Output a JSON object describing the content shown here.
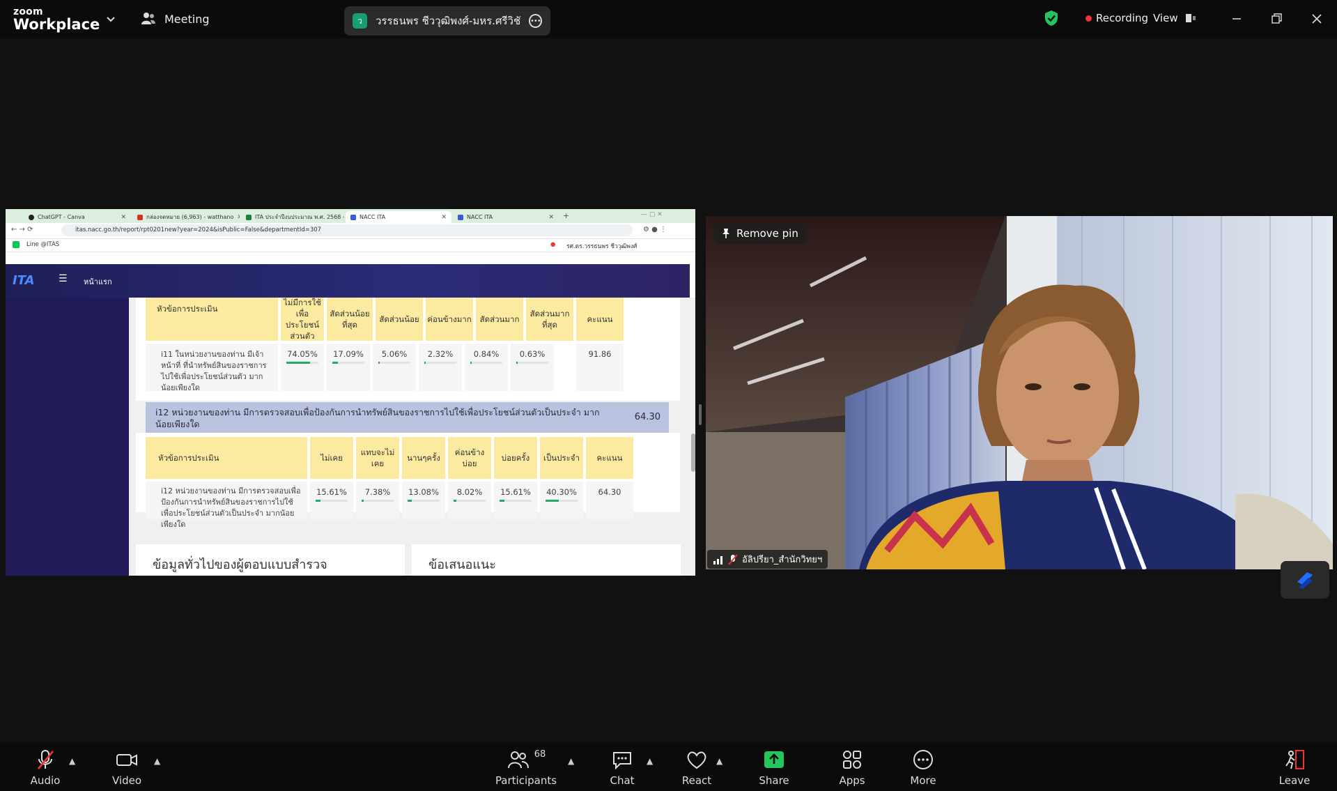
{
  "app": {
    "logo_line1": "zoom",
    "logo_line2": "Workplace",
    "meeting_label": "Meeting",
    "speaker_initial": "ว",
    "speaker_name": "วรรธนพร  ชีววุฒิพงศ์-มหร.ศรีวิชัย's sc",
    "recording_label": "Recording",
    "view_label": "View",
    "security_color": "#22c55e",
    "recording_color": "#f0323c"
  },
  "browser": {
    "tabs": [
      "ChatGPT - Canva",
      "กล่องจดหมาย (6,963) - watthano",
      "ITA ประจำปีงบประมาณ พ.ศ. 2568 -",
      "NACC ITA",
      "NACC ITA"
    ],
    "url": "itas.nacc.go.th/report/rpt0201new?year=2024&isPublic=False&departmentId=307",
    "bookmark": "Line @ITAS",
    "user": "รศ.ดร.วรรธนพร ชีววุฒิพงศ์"
  },
  "site": {
    "logo": "ITA",
    "home": "หน้าแรก"
  },
  "table1": {
    "headers": [
      "หัวข้อการประเมิน",
      "ไม่มีการใช้เพื่อประโยชน์ส่วนตัว",
      "สัดส่วนน้อยที่สุด",
      "สัดส่วนน้อย",
      "ค่อนข้างมาก",
      "สัดส่วนมาก",
      "สัดส่วนมากที่สุด",
      "คะแนน"
    ],
    "row_title": "i11 ในหน่วยงานของท่าน มีเจ้าหน้าที่ ที่นำทรัพย์สินของราชการไปใช้เพื่อประโยชน์ส่วนตัว มากน้อยเพียงใด",
    "values": [
      "74.05%",
      "17.09%",
      "5.06%",
      "2.32%",
      "0.84%",
      "0.63%"
    ],
    "fractions": [
      0.7405,
      0.1709,
      0.0506,
      0.0232,
      0.0084,
      0.0063
    ],
    "score": "91.86"
  },
  "i12": {
    "title": "i12 หน่วยงานของท่าน มีการตรวจสอบเพื่อป้องกันการนำทรัพย์สินของราชการไปใช้เพื่อประโยชน์ส่วนตัวเป็นประจำ มากน้อยเพียงใด",
    "score": "64.30"
  },
  "table2": {
    "headers": [
      "หัวข้อการประเมิน",
      "ไม่เคย",
      "แทบจะไม่เคย",
      "นานๆครั้ง",
      "ค่อนข้างบ่อย",
      "บ่อยครั้ง",
      "เป็นประจำ",
      "คะแนน"
    ],
    "row_title": "i12 หน่วยงานของท่าน มีการตรวจสอบเพื่อป้องกันการนำทรัพย์สินของราชการไปใช้เพื่อประโยชน์ส่วนตัวเป็นประจำ มากน้อยเพียงใด",
    "values": [
      "15.61%",
      "7.38%",
      "13.08%",
      "8.02%",
      "15.61%",
      "40.30%"
    ],
    "fractions": [
      0.1561,
      0.0738,
      0.1308,
      0.0802,
      0.1561,
      0.403
    ],
    "score": "64.30"
  },
  "sections": {
    "left": "ข้อมูลทั่วไปของผู้ตอบแบบสำรวจ",
    "right": "ข้อเสนอแนะ"
  },
  "video": {
    "remove_pin": "Remove pin",
    "participant_name": "อัลิปรียา_สำนักวิทยฯ"
  },
  "toolbar": {
    "audio": "Audio",
    "video": "Video",
    "participants": "Participants",
    "participants_count": "68",
    "chat": "Chat",
    "react": "React",
    "share": "Share",
    "apps": "Apps",
    "more": "More",
    "leave": "Leave",
    "share_color": "#22c55e"
  }
}
